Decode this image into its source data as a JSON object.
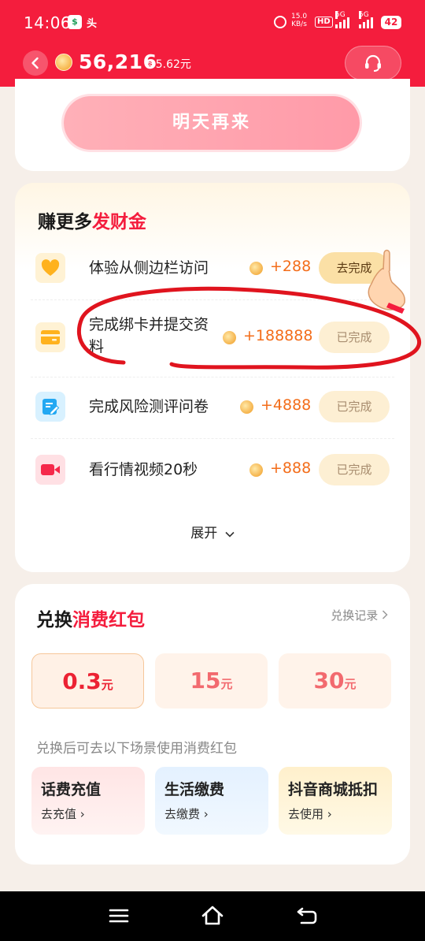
{
  "status_bar": {
    "time": "14:06",
    "app_badge": "头",
    "net_speed_top": "15.0",
    "net_speed_bottom": "KB/s",
    "hd": "HD",
    "signal1": "5G",
    "signal2": "5G",
    "battery": "42"
  },
  "header": {
    "balance": "56,216",
    "approx": "≈5.62元"
  },
  "card_top": {
    "button": "明天再来"
  },
  "earn": {
    "title_plain": "赚更多",
    "title_highlight": "发财金",
    "tasks": [
      {
        "name": "体验从侧边栏访问",
        "reward": "+288",
        "button": "去完成",
        "icon": "heart-icon",
        "done": false
      },
      {
        "name": "完成绑卡并提交资料",
        "reward": "+188888",
        "button": "已完成",
        "icon": "card-icon",
        "done": true
      },
      {
        "name": "完成风险测评问卷",
        "reward": "+4888",
        "button": "已完成",
        "icon": "edit-icon",
        "done": true
      },
      {
        "name": "看行情视频20秒",
        "reward": "+888",
        "button": "已完成",
        "icon": "video-icon",
        "done": true
      }
    ],
    "expand": "展开"
  },
  "exchange": {
    "title_plain": "兑换",
    "title_highlight": "消费红包",
    "records": "兑换记录",
    "amounts": [
      {
        "value": "0.3",
        "unit": "元",
        "selected": true
      },
      {
        "value": "15",
        "unit": "元",
        "selected": false
      },
      {
        "value": "30",
        "unit": "元",
        "selected": false
      }
    ],
    "hint": "兑换后可去以下场景使用消费红包",
    "scenes": [
      {
        "title": "话费充值",
        "action": "去充值"
      },
      {
        "title": "生活缴费",
        "action": "去缴费"
      },
      {
        "title": "抖音商城抵扣",
        "action": "去使用"
      }
    ]
  },
  "colors": {
    "brand_red": "#f41d3d",
    "reward_orange": "#f36d1a",
    "scribble_red": "#e0141e"
  }
}
